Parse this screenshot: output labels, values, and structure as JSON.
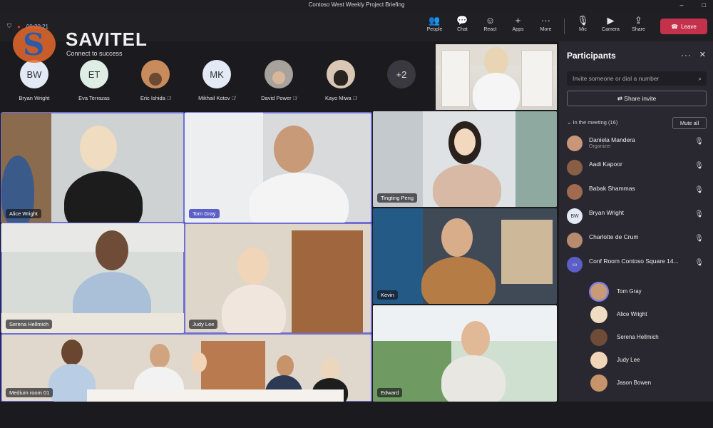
{
  "window": {
    "title": "Contoso West Weekly Project Briefing",
    "min": "–",
    "max": "□"
  },
  "status": {
    "timer": "00:30:21"
  },
  "logo": {
    "name": "SAVITEL",
    "tagline": "Connect to success"
  },
  "toolbar": {
    "tools": [
      {
        "icon": "people-icon",
        "glyph": "👥",
        "label": "People"
      },
      {
        "icon": "chat-icon",
        "glyph": "💬",
        "label": "Chat"
      },
      {
        "icon": "react-icon",
        "glyph": "☺",
        "label": "React"
      },
      {
        "icon": "apps-icon",
        "glyph": "+",
        "label": "Apps"
      },
      {
        "icon": "more-icon",
        "glyph": "···",
        "label": "More"
      }
    ],
    "media": [
      {
        "icon": "mic-icon",
        "glyph": "🎙",
        "label": "Mic"
      },
      {
        "icon": "camera-icon",
        "glyph": "▶",
        "label": "Camera"
      },
      {
        "icon": "share-icon",
        "glyph": "⇪",
        "label": "Share"
      }
    ],
    "leave_label": "Leave"
  },
  "avatars": [
    {
      "initials": "BW",
      "name": "Bryan Wright",
      "muted": false,
      "bg": "#e3e9f5"
    },
    {
      "initials": "ET",
      "name": "Eva Terrazas",
      "muted": false,
      "bg": "#dfeee4"
    },
    {
      "initials": "",
      "name": "Eric Ishida",
      "muted": true,
      "bg": "#c98b5c"
    },
    {
      "initials": "MK",
      "name": "Mikhail Kotov",
      "muted": true,
      "bg": "#e3e9f5"
    },
    {
      "initials": "",
      "name": "David Power",
      "muted": true,
      "bg": "#a7a39c"
    },
    {
      "initials": "",
      "name": "Kayo Miwa",
      "muted": true,
      "bg": "#d9c7b6"
    }
  ],
  "overflow_count": "+2",
  "tiles": [
    {
      "name": "Alice Wright",
      "active": false
    },
    {
      "name": "Tom Gray",
      "active": true
    },
    {
      "name": "Serena Hellmich",
      "active": false
    },
    {
      "name": "Judy Lee",
      "active": false
    },
    {
      "name": "Medium room 01",
      "active": false
    },
    {
      "name": "Tingting Peng",
      "active": false
    },
    {
      "name": "Kevin",
      "active": false
    },
    {
      "name": "Edward",
      "active": false
    }
  ],
  "panel": {
    "title": "Participants",
    "invite_placeholder": "Invite someone or dial a number",
    "share_invite": "Share invite",
    "in_meeting": "In the meeting (16)",
    "mute_all": "Mute all",
    "people": [
      {
        "name": "Daniela Mandera",
        "role": "Organizer"
      },
      {
        "name": "Aadi Kapoor",
        "role": ""
      },
      {
        "name": "Babak Shammas",
        "role": ""
      },
      {
        "name": "Bryan Wright",
        "role": "",
        "initials": "BW"
      },
      {
        "name": "Charlotte de Crum",
        "role": ""
      },
      {
        "name": "Conf Room Contoso Square 14...",
        "role": ""
      }
    ],
    "room_members": [
      "Tom Gray",
      "Alice Wright",
      "Serena Hellmich",
      "Judy Lee",
      "Jason Bowen"
    ]
  }
}
